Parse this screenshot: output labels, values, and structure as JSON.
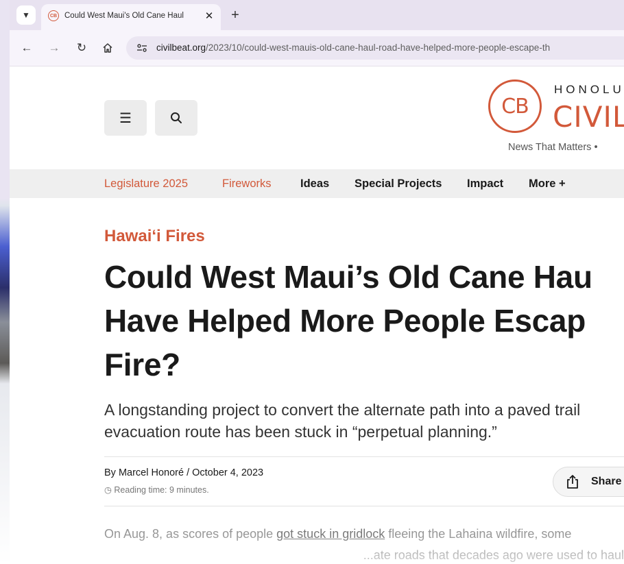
{
  "browser": {
    "tab": {
      "title": "Could West Maui's Old Cane Haul",
      "favicon": "CB"
    },
    "url_domain": "civilbeat.org",
    "url_path": "/2023/10/could-west-mauis-old-cane-haul-road-have-helped-more-people-escape-th",
    "icons": {
      "tab_list": "chevron-down-icon",
      "close": "close-icon",
      "new_tab": "plus-icon",
      "back": "arrow-left-icon",
      "forward": "arrow-right-icon",
      "reload": "reload-icon",
      "home": "home-icon",
      "site_info": "site-settings-icon"
    }
  },
  "site": {
    "logo": {
      "mark": "CB",
      "top_line": "HONOLU",
      "name": "CIVIL"
    },
    "tagline": "News That Matters •",
    "nav": [
      {
        "label": "Legislature 2025",
        "accent": true
      },
      {
        "label": "Fireworks",
        "accent": true
      },
      {
        "label": "Ideas",
        "accent": false
      },
      {
        "label": "Special Projects",
        "accent": false
      },
      {
        "label": "Impact",
        "accent": false
      },
      {
        "label": "More +",
        "accent": false
      }
    ],
    "accent_color": "#d2593a"
  },
  "article": {
    "kicker": "Hawai‘i Fires",
    "headline_lines": [
      "Could West Maui’s Old Cane Hau",
      "Have Helped More People Escap",
      "Fire?"
    ],
    "dek_lines": [
      "A longstanding project to convert the alternate path into a paved trail",
      "evacuation route has been stuck in “perpetual planning.”"
    ],
    "byline": "By Marcel Honoré  /  October 4, 2023",
    "reading_time": "Reading time: 9 minutes.",
    "share_label": "Share",
    "body": {
      "line1_before": "On Aug. 8, as scores of people ",
      "line1_link": "got stuck in gridlock",
      "line1_after": " fleeing the Lahaina wildfire, some",
      "line2": "...ate roads that decades ago were used to haul"
    }
  }
}
